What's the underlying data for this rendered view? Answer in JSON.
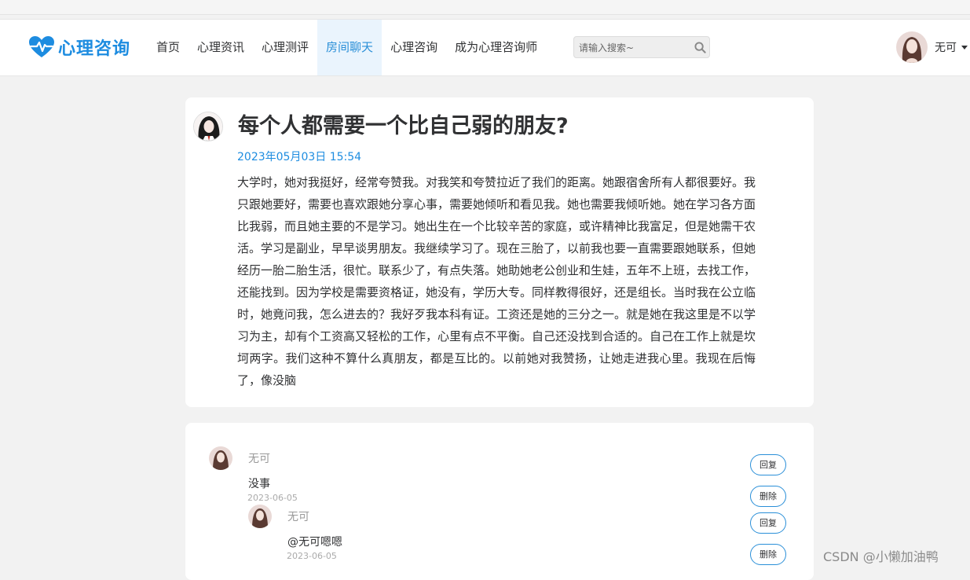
{
  "brand": {
    "name": "心理咨询",
    "color": "#1d8ce0"
  },
  "nav": [
    "首页",
    "心理资讯",
    "心理测评",
    "房间聊天",
    "心理咨询",
    "成为心理咨询师"
  ],
  "nav_active": "房间聊天",
  "search": {
    "placeholder": "请输入搜索~"
  },
  "user": {
    "name": "无可"
  },
  "post": {
    "title": "每个人都需要一个比自己弱的朋友?",
    "date": "2023年05月03日 15:54",
    "body": "大学时，她对我挺好，经常夸赞我。对我笑和夸赞拉近了我们的距离。她跟宿舍所有人都很要好。我只跟她要好，需要也喜欢跟她分享心事，需要她倾听和看见我。她也需要我倾听她。她在学习各方面比我弱，而且她主要的不是学习。她出生在一个比较辛苦的家庭，或许精神比我富足，但是她需干农活。学习是副业，早早谈男朋友。我继续学习了。现在三胎了，以前我也要一直需要跟她联系，但她经历一胎二胎生活，很忙。联系少了，有点失落。她助她老公创业和生娃，五年不上班，去找工作，还能找到。因为学校是需要资格证，她没有，学历大专。同样教得很好，还是组长。当时我在公立临时，她竟问我，怎么进去的？我好歹我本科有证。工资还是她的三分之一。就是她在我这里是不以学习为主，却有个工资高又轻松的工作，心里有点不平衡。自己还没找到合适的。自己在工作上就是坎坷两字。我们这种不算什么真朋友，都是互比的。以前她对我赞扬，让她走进我心里。我现在后悔了，像没脑"
  },
  "comments": [
    {
      "user": "无可",
      "text": "没事",
      "date": "2023-06-05"
    },
    {
      "user": "无可",
      "text": "@无可嗯嗯",
      "date": "2023-06-05"
    }
  ],
  "buttons": {
    "reply": "回复",
    "delete": "删除"
  },
  "watermark": "CSDN @小懒加油鸭"
}
